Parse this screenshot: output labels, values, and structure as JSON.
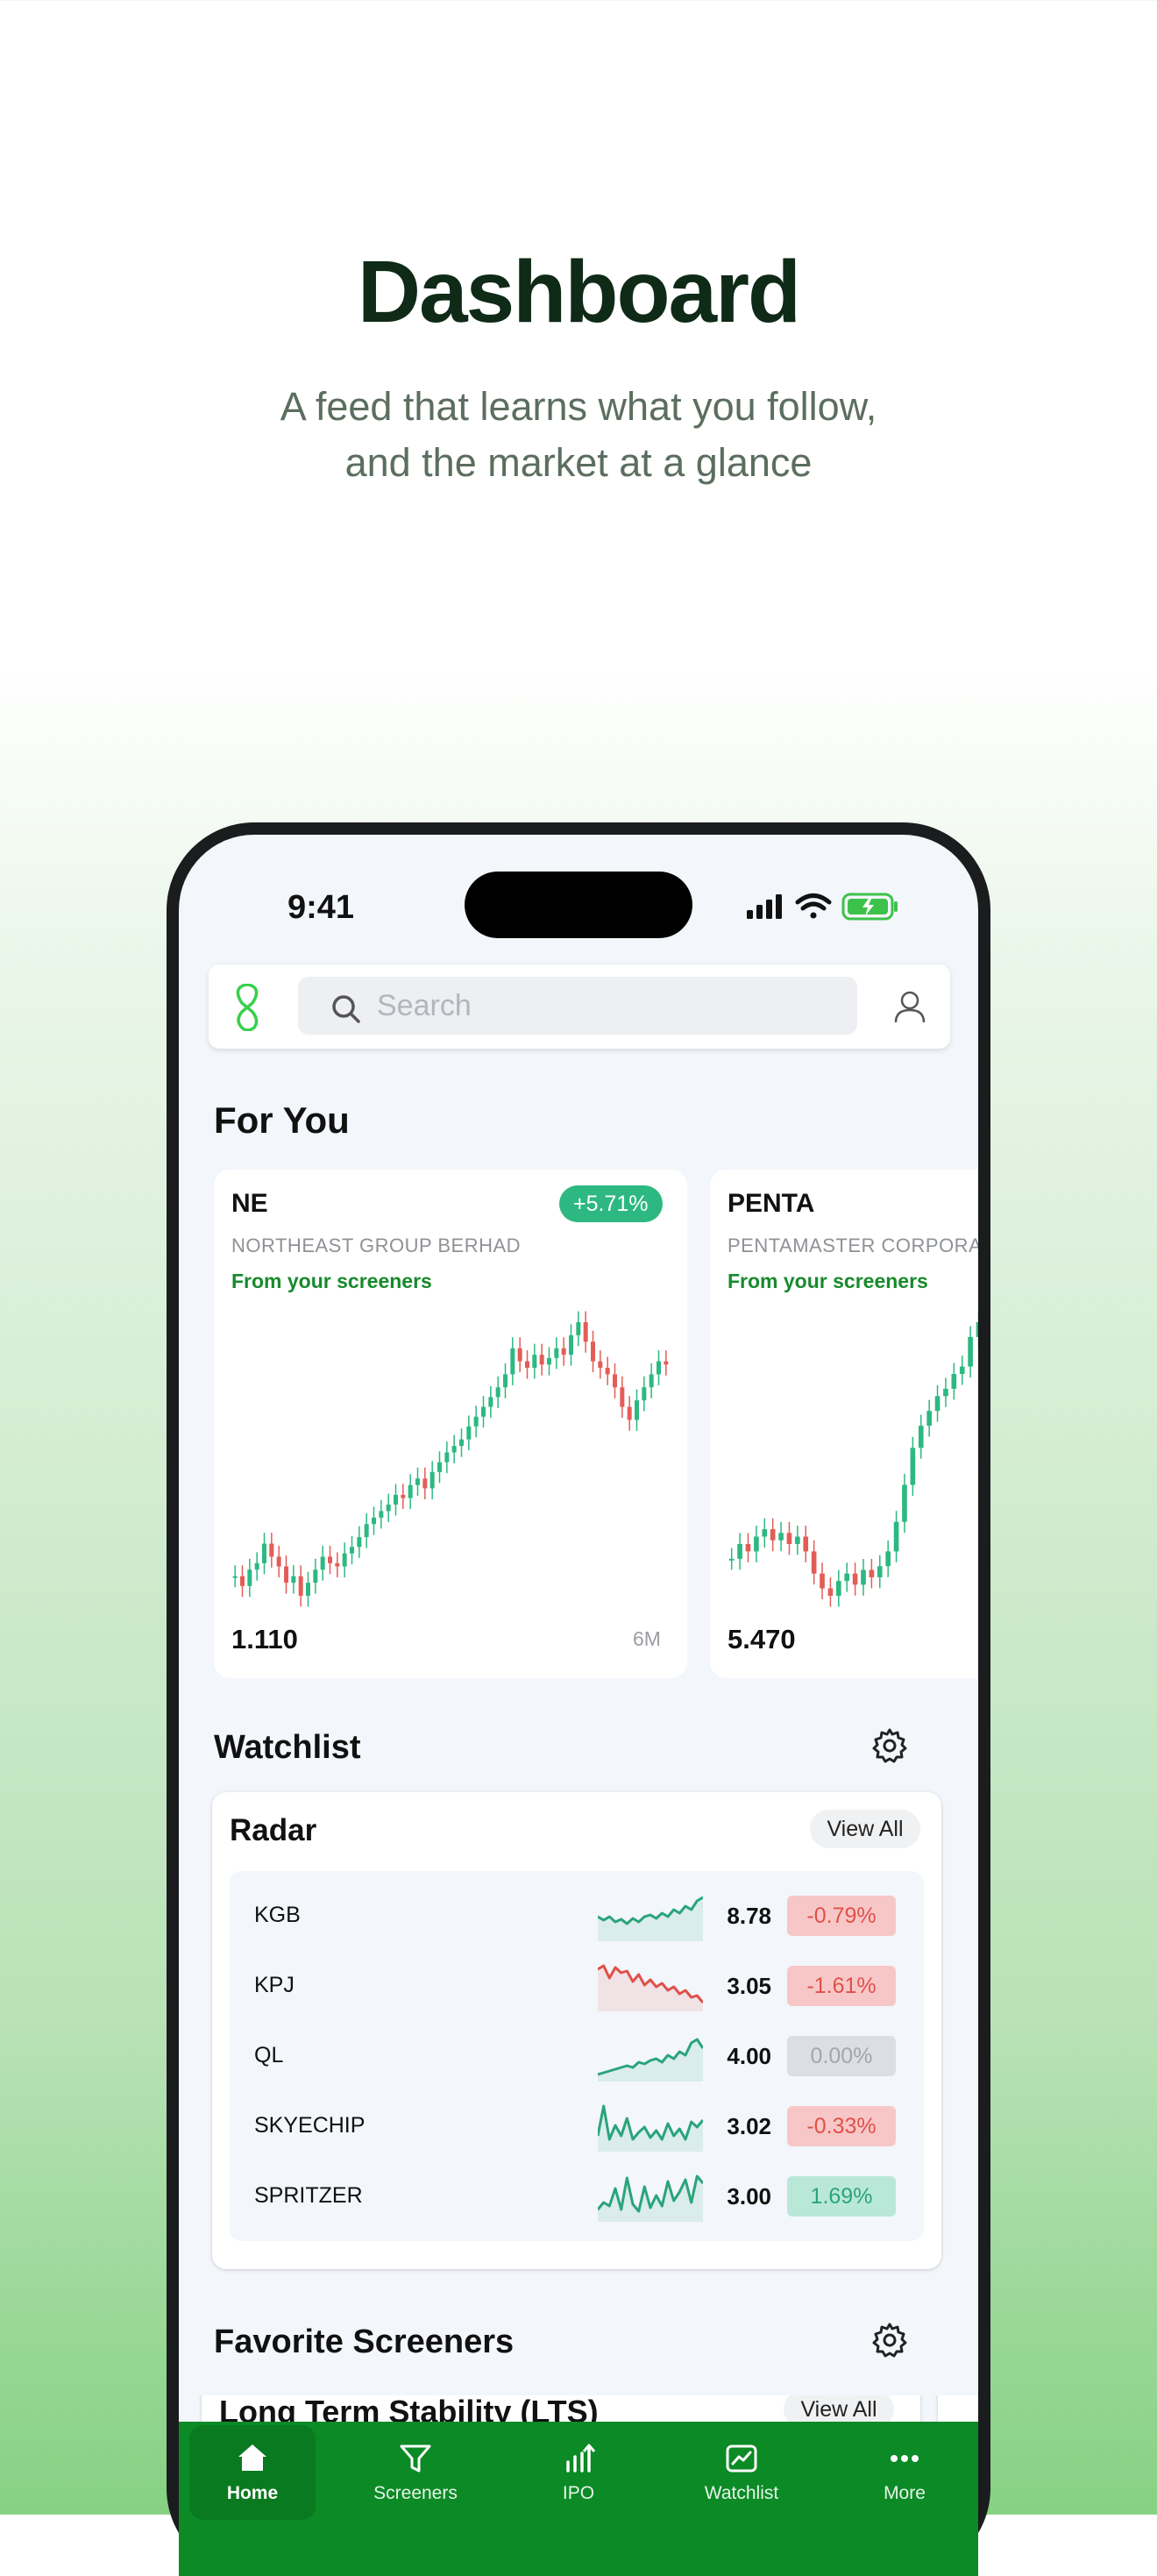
{
  "hero": {
    "title": "Dashboard",
    "subtitle_line1": "A feed that learns what you follow,",
    "subtitle_line2": "and the market at a glance"
  },
  "status_bar": {
    "time": "9:41",
    "icons": [
      "signal-icon",
      "wifi-icon",
      "battery-charging-icon"
    ]
  },
  "topbar": {
    "logo": "app-logo-icon",
    "search_placeholder": "Search",
    "profile": "profile-icon"
  },
  "for_you": {
    "title": "For You",
    "cards": [
      {
        "ticker": "NE",
        "change": "+5.71%",
        "company": "NORTHEAST GROUP BERHAD",
        "source": "From your screeners",
        "price": "1.110",
        "period": "6M"
      },
      {
        "ticker": "PENTA",
        "company": "PENTAMASTER CORPORATION",
        "source": "From your screeners",
        "price": "5.470"
      }
    ]
  },
  "watchlist": {
    "title": "Watchlist",
    "card_title": "Radar",
    "view_all": "View All",
    "rows": [
      {
        "symbol": "KGB",
        "price": "8.78",
        "change": "-0.79%",
        "trend": "neg",
        "spark": [
          30,
          34,
          30,
          36,
          33,
          38,
          32,
          36,
          30,
          28,
          32,
          26,
          30,
          22,
          26,
          18,
          22,
          12,
          8
        ]
      },
      {
        "symbol": "KPJ",
        "price": "3.05",
        "change": "-1.61%",
        "trend": "neg",
        "spark": [
          10,
          6,
          20,
          8,
          14,
          12,
          24,
          16,
          28,
          22,
          30,
          26,
          34,
          30,
          38,
          34,
          42,
          40,
          48
        ]
      },
      {
        "symbol": "QL",
        "price": "4.00",
        "change": "0.00%",
        "trend": "zero",
        "spark": [
          50,
          48,
          46,
          44,
          42,
          40,
          42,
          36,
          38,
          34,
          32,
          36,
          28,
          32,
          24,
          28,
          14,
          10,
          20
        ]
      },
      {
        "symbol": "SKYECHIP",
        "price": "3.02",
        "change": "-0.33%",
        "trend": "neg",
        "spark": [
          40,
          6,
          44,
          28,
          40,
          20,
          44,
          36,
          30,
          42,
          34,
          44,
          26,
          40,
          32,
          44,
          24,
          30,
          22
        ]
      },
      {
        "symbol": "SPRITZER",
        "price": "3.00",
        "change": "1.69%",
        "trend": "pos",
        "spark": [
          44,
          36,
          40,
          20,
          44,
          8,
          38,
          46,
          18,
          42,
          28,
          40,
          12,
          34,
          24,
          10,
          36,
          6,
          14
        ]
      }
    ]
  },
  "favorites": {
    "title": "Favorite Screeners",
    "card_title": "Long Term Stability (LTS)",
    "view_all": "View All"
  },
  "tabbar": {
    "tabs": [
      {
        "label": "Home",
        "icon": "home-icon",
        "active": true
      },
      {
        "label": "Screeners",
        "icon": "filter-icon",
        "active": false
      },
      {
        "label": "IPO",
        "icon": "ipo-chart-icon",
        "active": false
      },
      {
        "label": "Watchlist",
        "icon": "watchlist-chart-icon",
        "active": false
      },
      {
        "label": "More",
        "icon": "more-dots-icon",
        "active": false
      }
    ]
  },
  "colors": {
    "brand_green": "#0b8a25",
    "accent_green": "#2db882",
    "up_candle": "#2db882",
    "down_candle": "#e35d57"
  },
  "chart_data": [
    {
      "type": "candlestick",
      "series_ref": "NE",
      "period": "6M",
      "closes": [
        0.6,
        0.57,
        0.62,
        0.64,
        0.7,
        0.66,
        0.63,
        0.58,
        0.6,
        0.54,
        0.58,
        0.62,
        0.66,
        0.64,
        0.63,
        0.67,
        0.69,
        0.72,
        0.76,
        0.78,
        0.8,
        0.82,
        0.85,
        0.84,
        0.88,
        0.9,
        0.87,
        0.92,
        0.95,
        0.98,
        1.0,
        1.02,
        1.06,
        1.09,
        1.12,
        1.15,
        1.18,
        1.22,
        1.3,
        1.26,
        1.24,
        1.28,
        1.25,
        1.27,
        1.3,
        1.28,
        1.34,
        1.38,
        1.32,
        1.26,
        1.24,
        1.22,
        1.18,
        1.12,
        1.08,
        1.14,
        1.18,
        1.22,
        1.26,
        1.25
      ]
    },
    {
      "type": "candlestick",
      "series_ref": "PENTA",
      "closes": [
        4.7,
        4.74,
        4.72,
        4.76,
        4.78,
        4.75,
        4.77,
        4.74,
        4.76,
        4.72,
        4.66,
        4.62,
        4.6,
        4.64,
        4.66,
        4.63,
        4.67,
        4.65,
        4.68,
        4.72,
        4.8,
        4.9,
        5.0,
        5.06,
        5.1,
        5.14,
        5.16,
        5.2,
        5.22,
        5.3,
        5.34,
        5.32,
        5.28
      ]
    }
  ]
}
